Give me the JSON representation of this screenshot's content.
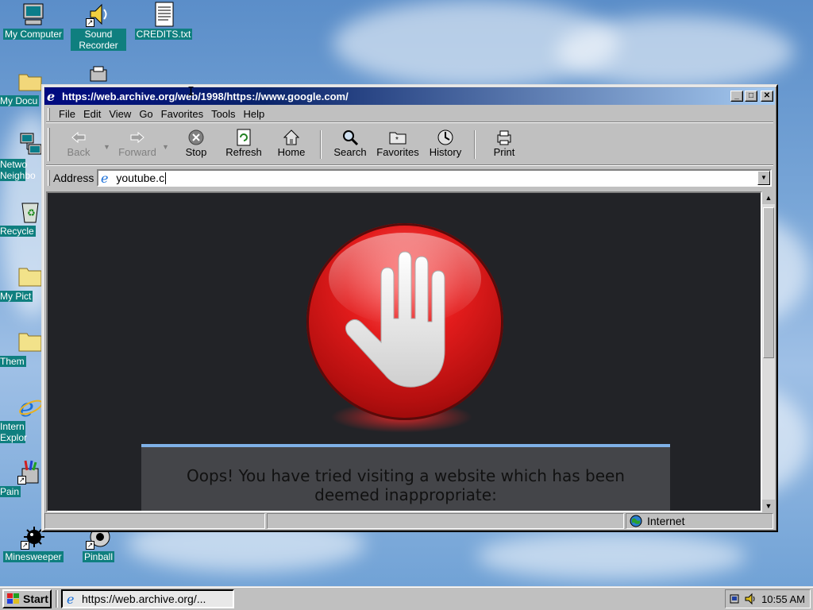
{
  "desktop": {
    "icons": [
      {
        "label": "My Computer"
      },
      {
        "label": "Sound Recorder"
      },
      {
        "label": "CREDITS.txt"
      },
      {
        "label": "My Docu"
      },
      {
        "label": "Netwo Neighbo"
      },
      {
        "label": "Recycle"
      },
      {
        "label": "My Pict"
      },
      {
        "label": "Them"
      },
      {
        "label": "Intern Explor"
      },
      {
        "label": "Pain"
      },
      {
        "label": "Minesweeper"
      },
      {
        "label": "Pinball"
      }
    ]
  },
  "window": {
    "title": "https://web.archive.org/web/1998/https://www.google.com/",
    "menu": [
      "File",
      "Edit",
      "View",
      "Go",
      "Favorites",
      "Tools",
      "Help"
    ],
    "toolbar": {
      "back": "Back",
      "forward": "Forward",
      "stop": "Stop",
      "refresh": "Refresh",
      "home": "Home",
      "search": "Search",
      "favorites": "Favorites",
      "history": "History",
      "print": "Print"
    },
    "address": {
      "label": "Address",
      "value": "youtube.c"
    },
    "page": {
      "message": "Oops! You have tried visiting a website which has been deemed inappropriate:"
    },
    "status": {
      "zone": "Internet"
    }
  },
  "taskbar": {
    "start": "Start",
    "task": "https://web.archive.org/...",
    "clock": "10:55 AM"
  },
  "colors": {
    "title_gradient_start": "#000a80",
    "title_gradient_end": "#a6caf0",
    "stop_red": "#e31c1c",
    "page_bg": "#222327",
    "notice_accent": "#7fb0e6"
  }
}
